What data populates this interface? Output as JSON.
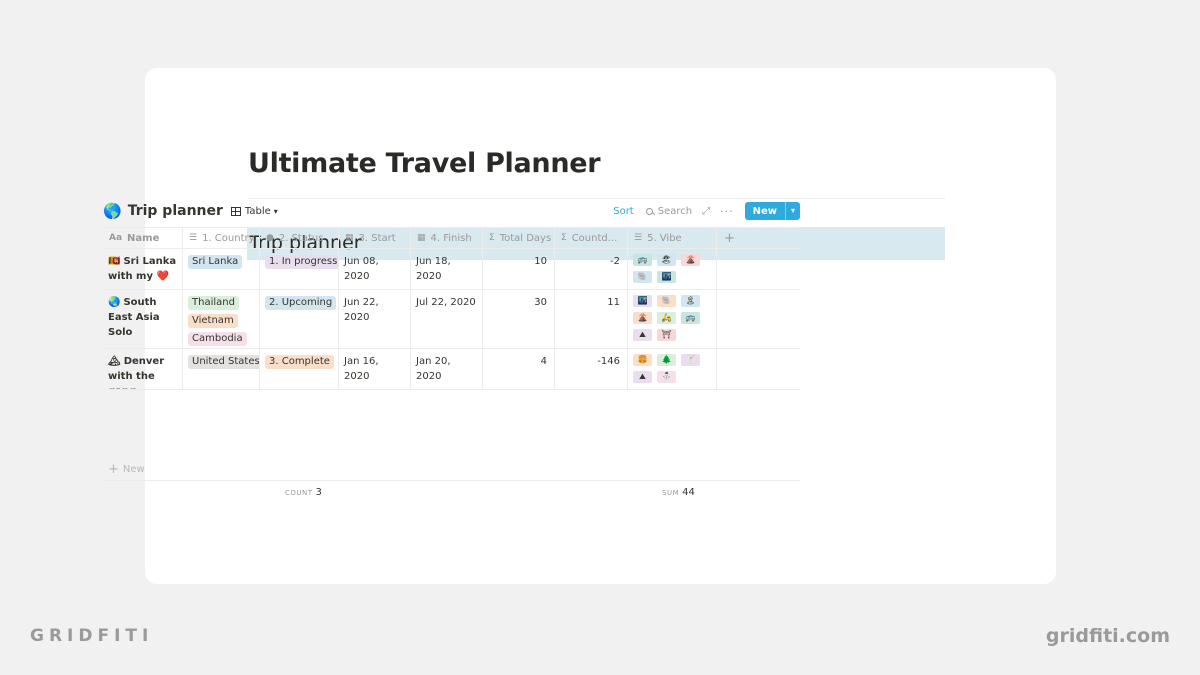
{
  "page": {
    "title": "Ultimate Travel Planner",
    "section_heading": "Trip planner"
  },
  "database": {
    "icon": "globe-emoji",
    "icon_glyph": "🌎",
    "title": "Trip planner",
    "view_label": "Table",
    "actions": {
      "sort": "Sort",
      "search": "Search",
      "new": "New"
    },
    "columns": [
      {
        "label": "Name",
        "icon": "Aa"
      },
      {
        "label": "1. Country",
        "icon": "☰"
      },
      {
        "label": "2. Status",
        "icon": "●"
      },
      {
        "label": "3. Start",
        "icon": "▦"
      },
      {
        "label": "4. Finish",
        "icon": "▦"
      },
      {
        "label": "Total Days",
        "icon": "Σ"
      },
      {
        "label": "Countd...",
        "icon": "Σ"
      },
      {
        "label": "5. Vibe",
        "icon": "☰"
      }
    ],
    "rows": [
      {
        "name_emoji": "🇱🇰",
        "name": "Sri Lanka with my ❤️",
        "countries": [
          {
            "label": "Sri Lanka",
            "color": "#d3e5ef"
          }
        ],
        "status": {
          "label": "1. In progress",
          "color": "#e8deee"
        },
        "start": "Jun 08, 2020",
        "finish": "Jun 18, 2020",
        "total_days": "10",
        "countdown": "-2",
        "vibes": [
          {
            "glyph": "🚌",
            "color": "#c6e6e0"
          },
          {
            "glyph": "🏖",
            "color": "#d3e5ef"
          },
          {
            "glyph": "🌋",
            "color": "#f6d8d8"
          },
          {
            "glyph": "🐘",
            "color": "#d3e5ef"
          },
          {
            "glyph": "🌃",
            "color": "#c6e6e0"
          }
        ]
      },
      {
        "name_emoji": "🌏",
        "name": "South East Asia Solo",
        "countries": [
          {
            "label": "Thailand",
            "color": "#dbeddb"
          },
          {
            "label": "Vietnam",
            "color": "#fadec9"
          },
          {
            "label": "Cambodia",
            "color": "#f5e0e9"
          }
        ],
        "status": {
          "label": "2. Upcoming",
          "color": "#d3e5ef"
        },
        "start": "Jun 22, 2020",
        "finish": "Jul 22, 2020",
        "total_days": "30",
        "countdown": "11",
        "vibes": [
          {
            "glyph": "🌃",
            "color": "#e8deee"
          },
          {
            "glyph": "🐘",
            "color": "#fadec9"
          },
          {
            "glyph": "🏝",
            "color": "#d3e5ef"
          },
          {
            "glyph": "🌋",
            "color": "#fadec9"
          },
          {
            "glyph": "🛵",
            "color": "#dbeddb"
          },
          {
            "glyph": "🚌",
            "color": "#c6e6e0"
          },
          {
            "glyph": "⛰",
            "color": "#e8deee"
          },
          {
            "glyph": "⛩",
            "color": "#f6d8d8"
          }
        ]
      },
      {
        "name_emoji": "🏔",
        "name": "Denver with the gang",
        "countries": [
          {
            "label": "United States",
            "color": "#e3e2e0"
          }
        ],
        "status": {
          "label": "3. Complete",
          "color": "#fadec9"
        },
        "start": "Jan 16, 2020",
        "finish": "Jan 20, 2020",
        "total_days": "4",
        "countdown": "-146",
        "vibes": [
          {
            "glyph": "🍔",
            "color": "#fadec9"
          },
          {
            "glyph": "🌲",
            "color": "#dbeddb"
          },
          {
            "glyph": "🍸",
            "color": "#e8deee"
          },
          {
            "glyph": "⛰",
            "color": "#e8deee"
          },
          {
            "glyph": "⛄",
            "color": "#f5e0e9"
          }
        ]
      }
    ],
    "new_row_label": "New",
    "footer": {
      "count_label": "COUNT",
      "count_value": "3",
      "sum_label": "SUM",
      "sum_value": "44"
    }
  },
  "branding": {
    "left": "GRIDFITI",
    "right": "gridfiti.com"
  }
}
